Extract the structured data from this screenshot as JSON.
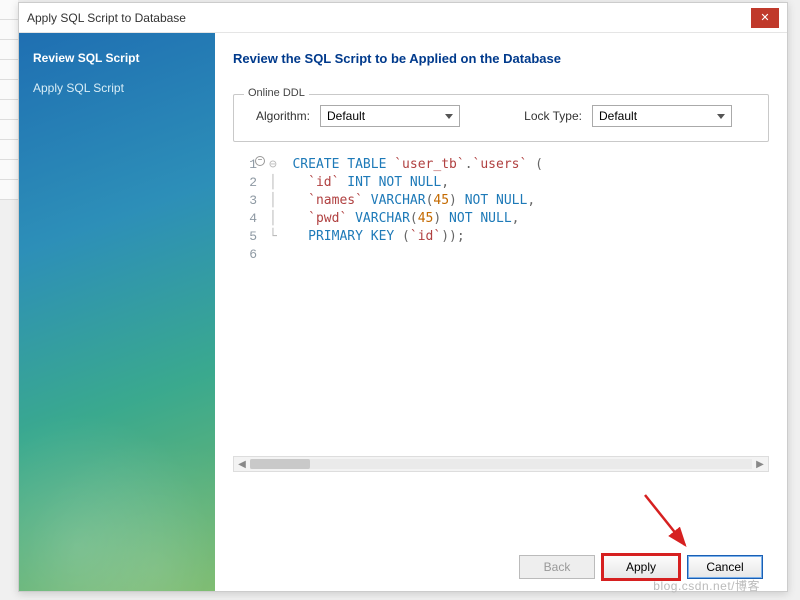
{
  "window": {
    "title": "Apply SQL Script to Database"
  },
  "sidebar": {
    "steps": [
      {
        "label": "Review SQL Script",
        "active": true
      },
      {
        "label": "Apply SQL Script",
        "active": false
      }
    ]
  },
  "main": {
    "heading": "Review the SQL Script to be Applied on the Database",
    "online_ddl": {
      "legend": "Online DDL",
      "algorithm_label": "Algorithm:",
      "algorithm_value": "Default",
      "lock_label": "Lock Type:",
      "lock_value": "Default"
    },
    "sql": {
      "line_count": 6,
      "tokens": {
        "l1": {
          "kw1": "CREATE TABLE",
          "t1": "`user_tb`",
          "dot": ".",
          "t2": "`users`",
          "p": " ("
        },
        "l2": {
          "col": "`id`",
          "kw": "INT NOT NULL",
          "c": ","
        },
        "l3": {
          "col": "`names`",
          "kw1": "VARCHAR",
          "p1": "(",
          "n": "45",
          "p2": ")",
          "kw2": "NOT NULL",
          "c": ","
        },
        "l4": {
          "col": "`pwd`",
          "kw1": "VARCHAR",
          "p1": "(",
          "n": "45",
          "p2": ")",
          "kw2": "NOT NULL",
          "c": ","
        },
        "l5": {
          "kw": "PRIMARY KEY",
          "p1": " (",
          "col": "`id`",
          "p2": "));"
        }
      }
    }
  },
  "buttons": {
    "back": "Back",
    "apply": "Apply",
    "cancel": "Cancel"
  },
  "watermark": "blog.csdn.net/博客"
}
